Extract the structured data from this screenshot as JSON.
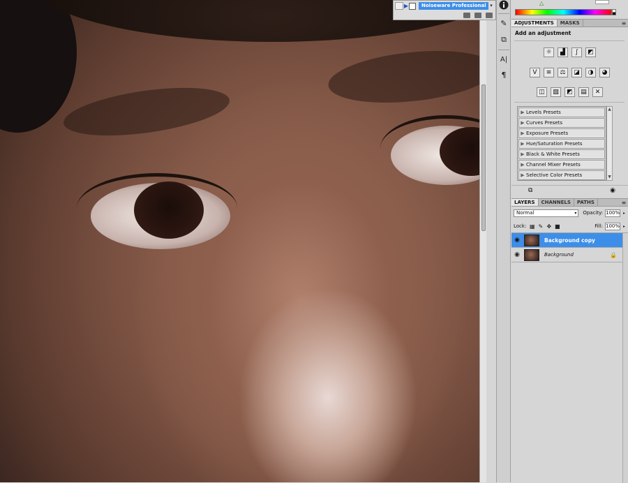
{
  "noiseware": {
    "label": "Noiseware Professional"
  },
  "dock": {
    "icons": [
      "info-icon",
      "brush-tool-icon",
      "clone-source-icon",
      "character-icon",
      "paragraph-icon"
    ],
    "character_glyph": "A|",
    "paragraph_glyph": "¶"
  },
  "adjustments_panel": {
    "tabs": [
      "ADJUSTMENTS",
      "MASKS"
    ],
    "active_tab": "ADJUSTMENTS",
    "title": "Add an adjustment",
    "presets": [
      "Levels Presets",
      "Curves Presets",
      "Exposure Presets",
      "Hue/Saturation Presets",
      "Black & White Presets",
      "Channel Mixer Presets",
      "Selective Color Presets"
    ]
  },
  "layers_panel": {
    "tabs": [
      "LAYERS",
      "CHANNELS",
      "PATHS"
    ],
    "active_tab": "LAYERS",
    "blend_mode": "Normal",
    "opacity_label": "Opacity:",
    "opacity_value": "100%",
    "lock_label": "Lock:",
    "fill_label": "Fill:",
    "fill_value": "100%",
    "layers": [
      {
        "name": "Background copy",
        "selected": true,
        "locked": false
      },
      {
        "name": "Background",
        "selected": false,
        "locked": true
      }
    ]
  },
  "colors": {
    "selection_blue": "#3d8ee8",
    "panel_bg": "#d6d6d6"
  }
}
